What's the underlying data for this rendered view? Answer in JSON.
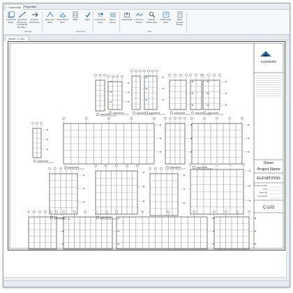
{
  "tabs": [
    {
      "label": "Contextual",
      "active": true
    },
    {
      "label": "Properties",
      "active": false
    }
  ],
  "ribbon": {
    "groups": [
      {
        "label": "Manage"
      },
      {
        "label": "Structural"
      },
      {
        "label": "Help"
      }
    ],
    "buttons": [
      {
        "label": "Control All Sheet",
        "icon": "sheet-stack-icon"
      },
      {
        "label": "Control All Dimension Constraints By Sheet",
        "icon": "dimension-icon"
      },
      {
        "label": "Expand Dimension",
        "icon": "expand-icon"
      },
      {
        "label": "Show Line Both",
        "icon": "line-icon"
      },
      {
        "label": "Show Plane Both",
        "icon": "plane-icon"
      },
      {
        "label": "Shelf",
        "icon": "shelf-icon"
      },
      {
        "label": "Sync",
        "icon": "sync-icon"
      },
      {
        "label": "Live Family Types",
        "icon": "family-icon"
      },
      {
        "label": "Export Levels",
        "icon": "levels-icon"
      },
      {
        "label": "Load Model",
        "icon": "load-icon"
      },
      {
        "label": "Live Line Model",
        "icon": "live-line-icon"
      },
      {
        "label": "Search Active View",
        "icon": "search-icon"
      },
      {
        "label": "Why? Load RAD",
        "icon": "why-icon"
      },
      {
        "label": "Make Forums Report",
        "icon": "report-icon"
      }
    ]
  },
  "view_tab": {
    "label": "Sheet: C-102"
  },
  "title_block": {
    "brand": "KAWNEER",
    "owner_label": "Owner",
    "project_name_label": "Project Name",
    "sheet_title": "ELEVATIONS",
    "sheet_number": "C-102",
    "rows": [
      "Project Number",
      "Date",
      "Drawn By",
      "Checked By"
    ]
  },
  "elevation_labels": [
    "ELEVATION",
    "ELEVATION",
    "ELEVATION",
    "ELEVATION",
    "ELEVATION",
    "ELEVATION",
    "ELEVATION",
    "ELEVATION",
    "ELEVATION",
    "ELEVATION",
    "ELEVATION",
    "ELEVATION",
    "ELEVATION"
  ],
  "colors": {
    "accent": "#1f6fb2",
    "line": "#222222",
    "grid": "#555555"
  }
}
